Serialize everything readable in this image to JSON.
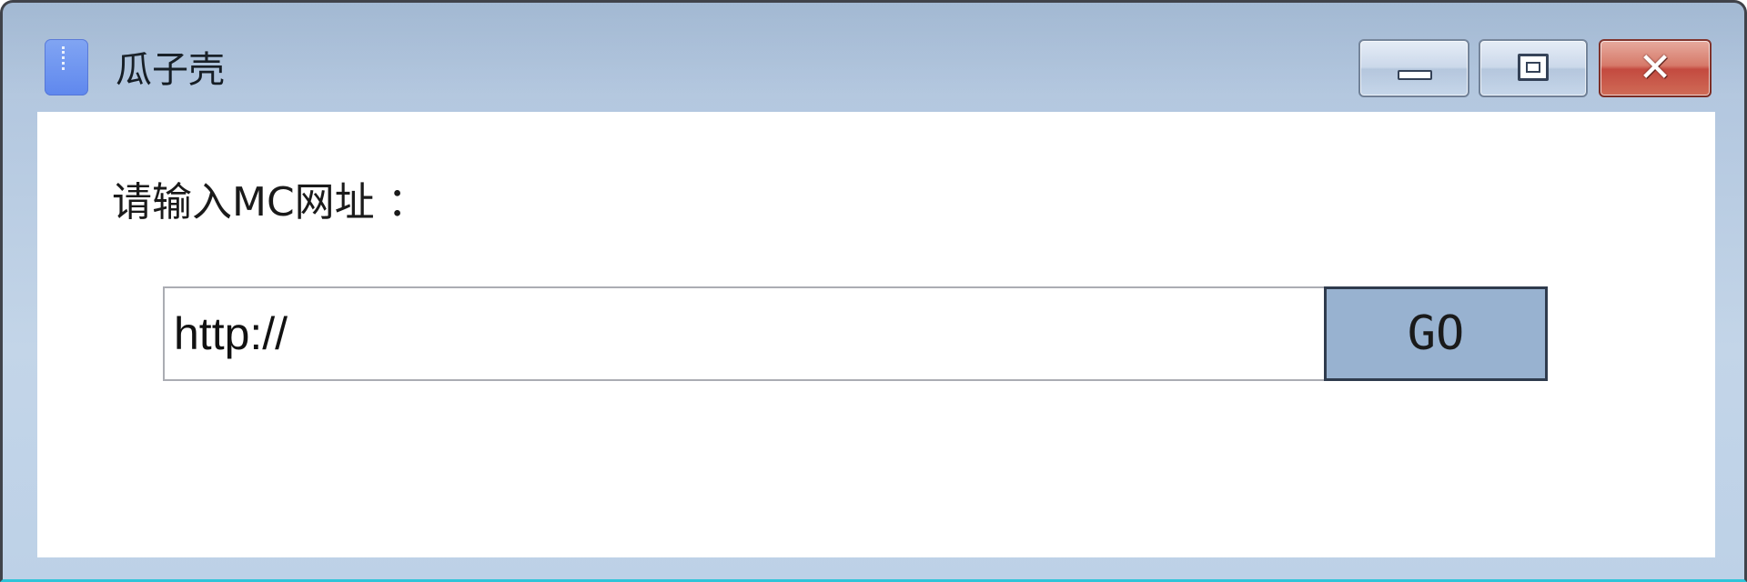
{
  "window": {
    "title": "瓜子壳",
    "controls": {
      "minimize": "minimize",
      "maximize": "maximize",
      "close": "close"
    }
  },
  "icons": {
    "app": "zip-archive-icon",
    "minimize": "minimize-icon",
    "maximize": "maximize-icon",
    "close": "close-icon"
  },
  "form": {
    "prompt_label": "请输入MC网址 ：",
    "url_value": "http://",
    "go_label": "GO"
  },
  "colors": {
    "titlebar": "#b3c7df",
    "close_button": "#c2453a",
    "go_button": "#98b2d0",
    "app_icon": "#6b93f0"
  }
}
